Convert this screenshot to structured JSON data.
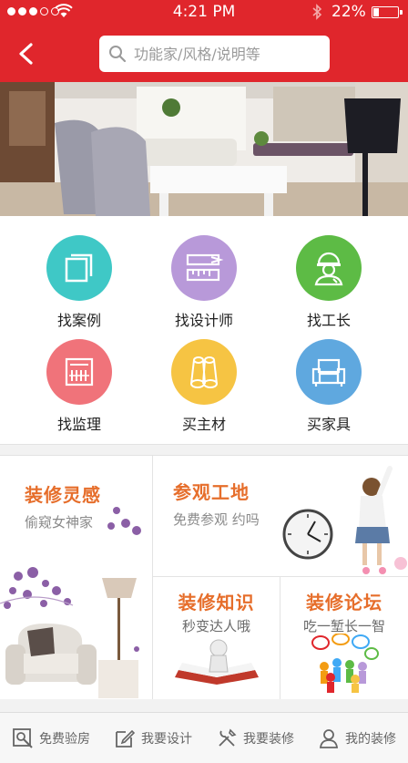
{
  "status_bar": {
    "time": "4:21 PM",
    "battery": "22%"
  },
  "search": {
    "placeholder": "功能家/风格/说明等"
  },
  "categories": [
    {
      "label": "找案例",
      "icon": "cards-icon",
      "color": "#3fc8c6"
    },
    {
      "label": "找设计师",
      "icon": "ruler-pencil-icon",
      "color": "#b899d9"
    },
    {
      "label": "找工长",
      "icon": "worker-helmet-icon",
      "color": "#5dbb45"
    },
    {
      "label": "找监理",
      "icon": "calculator-icon",
      "color": "#f0737a"
    },
    {
      "label": "买主材",
      "icon": "pipes-icon",
      "color": "#f6c443"
    },
    {
      "label": "买家具",
      "icon": "sofa-icon",
      "color": "#5fa8df"
    }
  ],
  "tiles": {
    "inspiration": {
      "title": "装修灵感",
      "subtitle": "偷窥女神家"
    },
    "visit": {
      "title": "参观工地",
      "subtitle": "免费参观 约吗"
    },
    "knowledge": {
      "title": "装修知识",
      "subtitle": "秒变达人哦"
    },
    "forum": {
      "title": "装修论坛",
      "subtitle": "吃一堑长一智"
    }
  },
  "tabbar": [
    {
      "label": "免费验房",
      "icon": "house-check-icon"
    },
    {
      "label": "我要设计",
      "icon": "edit-icon"
    },
    {
      "label": "我要装修",
      "icon": "tools-icon"
    },
    {
      "label": "我的装修",
      "icon": "user-icon"
    }
  ],
  "colors": {
    "brand_red": "#e0262c",
    "tile_orange": "#e66e2b"
  }
}
